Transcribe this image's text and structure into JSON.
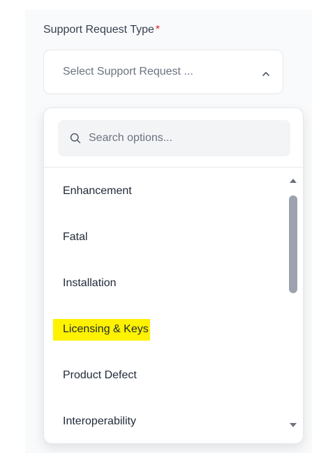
{
  "field": {
    "label": "Support Request Type",
    "required_mark": "*"
  },
  "select": {
    "value": "Select Support Request ...",
    "expanded": true,
    "chevron_icon": "chevron-up-icon"
  },
  "search": {
    "placeholder": "Search options...",
    "icon": "search-icon"
  },
  "options": [
    {
      "label": "Enhancement"
    },
    {
      "label": "Fatal"
    },
    {
      "label": "Installation"
    },
    {
      "label": "Licensing & Keys",
      "highlighted": true
    },
    {
      "label": "Product Defect"
    },
    {
      "label": "Interoperability"
    }
  ],
  "colors": {
    "highlight": "#fff200",
    "required": "#dc2626",
    "scrollbar_thumb": "#9ca3af"
  }
}
